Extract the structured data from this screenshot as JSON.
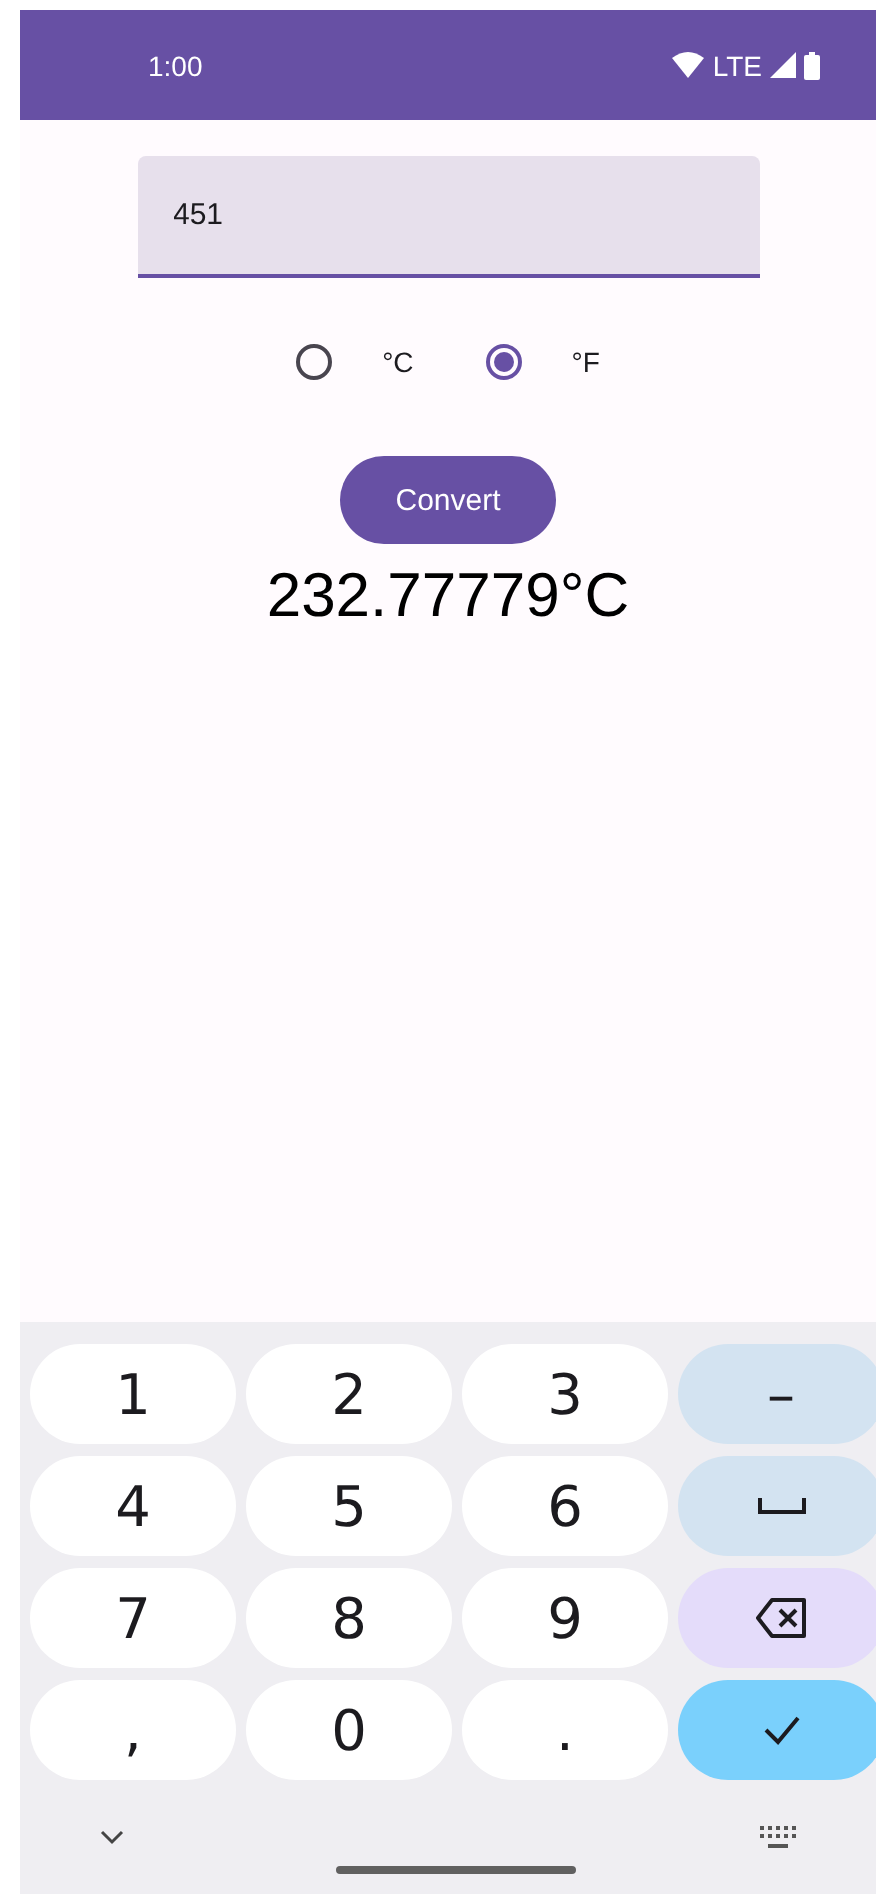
{
  "status_bar": {
    "time": "1:00",
    "network": "LTE"
  },
  "input": {
    "value": "451"
  },
  "units": [
    {
      "label": "°C",
      "selected": false
    },
    {
      "label": "°F",
      "selected": true
    }
  ],
  "convert_button": {
    "label": "Convert"
  },
  "result": "232.77779°C",
  "keyboard": {
    "keys": [
      {
        "kind": "char",
        "label": "1"
      },
      {
        "kind": "char",
        "label": "2"
      },
      {
        "kind": "char",
        "label": "3"
      },
      {
        "kind": "symbol",
        "label": "–"
      },
      {
        "kind": "char",
        "label": "4"
      },
      {
        "kind": "char",
        "label": "5"
      },
      {
        "kind": "char",
        "label": "6"
      },
      {
        "kind": "space"
      },
      {
        "kind": "char",
        "label": "7"
      },
      {
        "kind": "char",
        "label": "8"
      },
      {
        "kind": "char",
        "label": "9"
      },
      {
        "kind": "backspace"
      },
      {
        "kind": "char",
        "label": ","
      },
      {
        "kind": "char",
        "label": "0"
      },
      {
        "kind": "char",
        "label": "."
      },
      {
        "kind": "enter"
      }
    ]
  }
}
